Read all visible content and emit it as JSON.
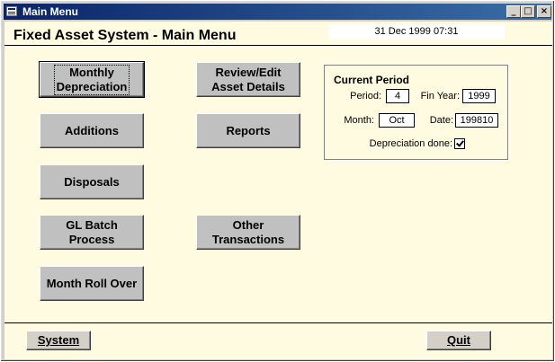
{
  "window": {
    "title": "Main Menu",
    "minimize_glyph": "_",
    "restore_glyph": "□",
    "close_glyph": "×"
  },
  "header": {
    "title": "Fixed Asset System - Main Menu",
    "datetime": "31 Dec 1999 07:31"
  },
  "menu": {
    "monthly_depreciation": "Monthly\nDepreciation",
    "additions": "Additions",
    "disposals": "Disposals",
    "gl_batch_process": "GL Batch\nProcess",
    "month_roll_over": "Month Roll Over",
    "review_edit_asset_details": "Review/Edit\nAsset Details",
    "reports": "Reports",
    "other_transactions": "Other\nTransactions"
  },
  "current_period": {
    "title": "Current Period",
    "period_label": "Period:",
    "period_value": "4",
    "fin_year_label": "Fin Year:",
    "fin_year_value": "1999",
    "month_label": "Month:",
    "month_value": "Oct",
    "date_label": "Date:",
    "date_value": "199810",
    "depreciation_done_label": "Depreciation done:",
    "depreciation_done": true
  },
  "footer": {
    "system_label": "System",
    "quit_label": "Quit"
  },
  "colors": {
    "form_background": "#fffbe0",
    "titlebar_start": "#0a246a",
    "titlebar_end": "#3a6ea5",
    "button_face": "#c0c0c0"
  }
}
